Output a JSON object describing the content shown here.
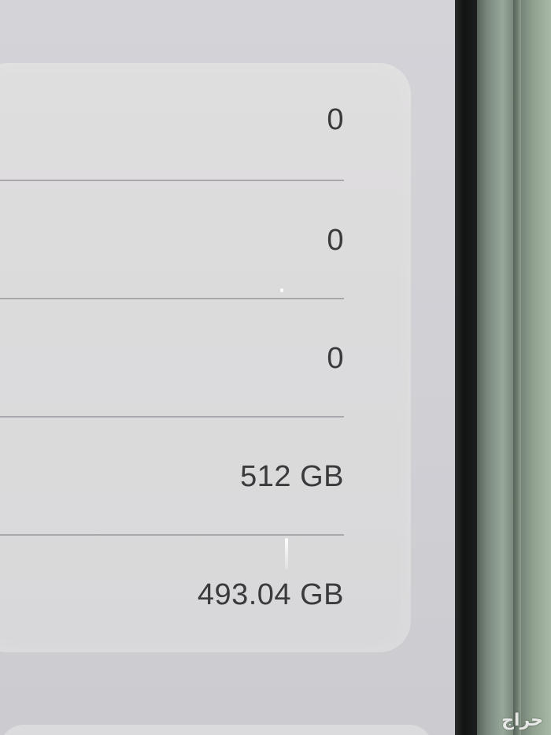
{
  "storage_details": {
    "rows": [
      {
        "value": "0"
      },
      {
        "value": "0"
      },
      {
        "value": "0"
      },
      {
        "value": "512 GB"
      },
      {
        "value": "493.04 GB"
      }
    ]
  },
  "watermark": "حراج",
  "colors": {
    "card_background": "#dcdbdc",
    "value_text": "#3a3a3d",
    "separator": "#a9a9ad",
    "phone_frame_green": "#8fa08f"
  }
}
